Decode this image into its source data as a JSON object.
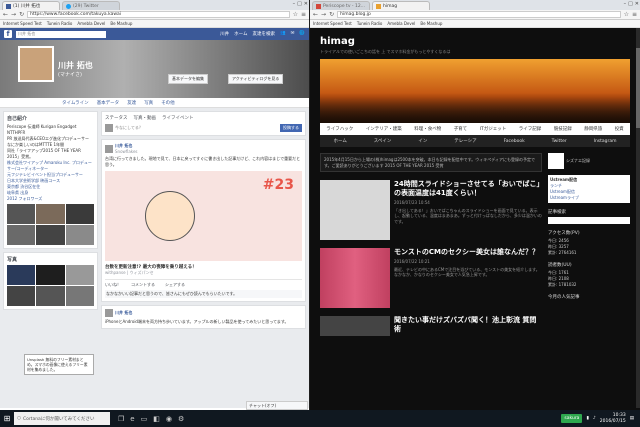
{
  "left_browser": {
    "tabs": [
      {
        "label": "(1) 川井 拓也"
      },
      {
        "label": "(29) Twitter"
      }
    ],
    "url": "https://www.facebook.com/takuya.kawai",
    "bookmarks": [
      "Internet Speed Test",
      "Tunein Radio",
      "Amebla Devel",
      "Be Mashup"
    ]
  },
  "facebook": {
    "logo": "f",
    "search_text": "川井 拓也",
    "nav": [
      "川井",
      "ホーム",
      "友達を検索"
    ],
    "profile_name": "川井 拓也",
    "profile_sub": "(マナイさ)",
    "cover_buttons": [
      "基本データを編集",
      "アクティビティログを見る"
    ],
    "tabs": [
      "タイムライン",
      "基本データ",
      "友達",
      "写真",
      "その他"
    ],
    "intro_title": "自己紹介",
    "intro_lines": [
      "Periscope  伝道師  Kurigan  Engadget  NTTHPFR",
      "PR  放送局代表&CEOエグ進化プロデューサー",
      "なにか楽しいのはMTTTE 1年間",
      "同社「ライフアップ2015 OF THE YEAR 2015」受賞。"
    ],
    "intro_links": [
      "株式会社ワイアップ Amaroku Inc. プロデューサー/コーディネーター",
      "元フジテレビイベント担当プロデューサー",
      "日本大学芸術学部 映画コース",
      "東京都 渋谷区在住",
      "岐阜県 出身",
      "2012 フォロワーズ"
    ],
    "photos_title": "写真",
    "composer_tabs": [
      "ステータス",
      "写真・動画",
      "ライフイベント"
    ],
    "composer_placeholder": "今なにしてる？",
    "composer_post": "投稿する",
    "post_author": "川井 拓也",
    "post_time": "Snowflakes",
    "post_text": "台湾に行ってきました。現地で見て、日本に戻ってすぐに書き出した記事だけど、これ内容はまじで重要だと思う。",
    "post_image_num": "#23",
    "post_link_title": "台数を更新注意!?  最大の喪障を乗り越える！",
    "post_link_site": "withpanse | ウィズパンセ",
    "post_actions": [
      "いいね！",
      "コメントする",
      "シェアする"
    ],
    "comment_text": "なかなかいい記事だと思うので、皆さんにもぜひ読んでもらいたいです。",
    "post2_author": "川井 拓也",
    "post2_text": "iPhoneとAndroid端末を両方持ち歩いています。アップルの新しい製品を使ってみたいと思ってます。",
    "chat_text": "Unsplash 無料のフリー素材まとめ。スマホの画像に使えるフリー素材を集めました。",
    "chat_footer": "チャット(オフ)"
  },
  "right_browser": {
    "tabs": [
      {
        "label": "Periscope tv - 12..."
      },
      {
        "label": "himag"
      }
    ],
    "url": "himag.blog.jp"
  },
  "blog": {
    "title": "himag",
    "description": "トライアルでの使いごこちの話を  上  でスマホ料金がもっとやすくなるは",
    "nav": [
      "ライフハック",
      "インテリア・建築",
      "料理・食べ物",
      "子育て",
      "ITガジェット",
      "ライフ記録",
      "競技記録",
      "静岡県旅",
      "投資"
    ],
    "menu": [
      "ホーム",
      "スペイン",
      "イン",
      "テレーシア",
      "Facebook",
      "Twitter",
      "Instagram"
    ],
    "notice": "2015年4月15日から上場の(株)himagは2500本を突破。本日も記録を配信中です。ウィキペディアにも登録の予定です。ご愛読ありがとうございます 2015 OF THE YEAR 2015 受賞",
    "articles": [
      {
        "title": "24時間スライドショーさせてる「おいでばこ」の表面温度は41度くらい！",
        "meta": "2016/07/23 10:54",
        "text": "「き出してある！」おいでばこちゃんのスライドショーを画面で見ている。表示し、起動している、温度はまあまあ。ずっと付けっぱなしだから、多少は温かいのです。"
      },
      {
        "title": "モンストのCMのセクシー美女は誰なんだ？？",
        "meta": "2016/07/22 10:21",
        "text": "最近、テレビの中にあるCMで注目を浴びている、モンストの美女を紹介します。なかなか、かなりのセクシー美女で人気急上昇です。"
      },
      {
        "title": "聞きたい事だけズバズバ聞く！池上彰流 質問術",
        "meta": "",
        "text": ""
      }
    ],
    "side_profile_label": "シズナエ記録",
    "side_links_title": "Ustream配信",
    "side_links": [
      "ランチ",
      "Ustream配信",
      "Ustreamライブ"
    ],
    "side_search_title": "記事検索",
    "side_pv_title": "アクセス数(PV)",
    "pv_stats": [
      {
        "label": "今日:",
        "value": "2456"
      },
      {
        "label": "昨日:",
        "value": "3257"
      },
      {
        "label": "累計:",
        "value": "2764161"
      }
    ],
    "side_uu_title": "読者数(UU)",
    "uu_stats": [
      {
        "label": "今日:",
        "value": "1761"
      },
      {
        "label": "昨日:",
        "value": "2108"
      },
      {
        "label": "累計:",
        "value": "1781032"
      }
    ],
    "side_popular_title": "今月の人気記事"
  },
  "taskbar": {
    "search_placeholder": "Cortanaに何か聞いてみてください",
    "tray_app": "sakura",
    "time": "10:33",
    "date": "2016/07/15"
  },
  "colors": {
    "facebook_blue": "#3b5998",
    "blog_bg": "#0e0e0e",
    "taskbar_bg": "#101820"
  }
}
